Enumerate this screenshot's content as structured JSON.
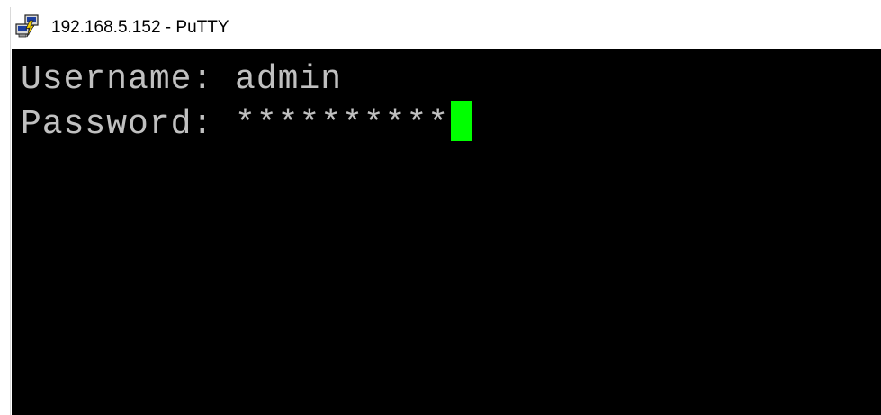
{
  "window": {
    "title": "192.168.5.152 - PuTTY",
    "icon": "putty-icon"
  },
  "terminal": {
    "lines": [
      {
        "label": "Username:",
        "value": "admin"
      },
      {
        "label": "Password:",
        "value": "**********"
      }
    ],
    "cursor_color": "#00ff00",
    "text_color": "#c0c0c0",
    "background": "#000000"
  }
}
